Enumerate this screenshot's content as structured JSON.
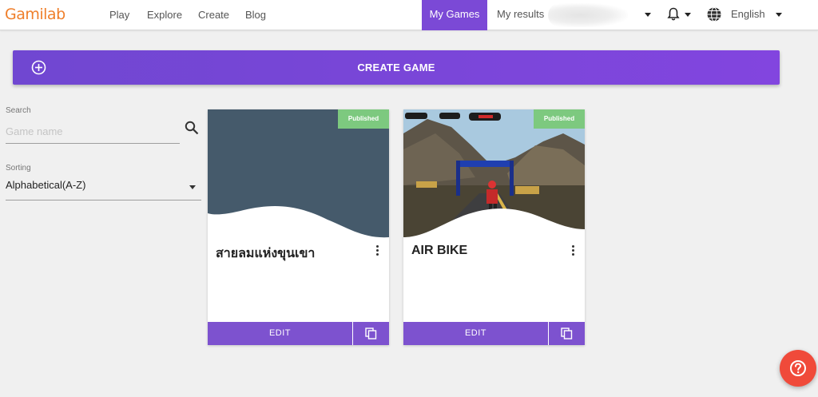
{
  "header": {
    "logo": "Gamilab",
    "nav": [
      "Play",
      "Explore",
      "Create",
      "Blog"
    ],
    "my_games": "My Games",
    "my_results": "My results",
    "language": "English"
  },
  "create": {
    "label": "CREATE GAME"
  },
  "filters": {
    "search_label": "Search",
    "search_placeholder": "Game name",
    "search_value": "",
    "sorting_label": "Sorting",
    "sorting_value": "Alphabetical(A-Z)"
  },
  "games": [
    {
      "title": "สายลมแห่งขุนเขา",
      "status": "Published",
      "edit": "EDIT",
      "image": "solid",
      "image_color": "#455a6b"
    },
    {
      "title": "AIR BIKE",
      "status": "Published",
      "edit": "EDIT",
      "image": "air-bike-scene"
    }
  ],
  "colors": {
    "accent": "#7b49d6",
    "published": "#7dc97f",
    "logo": "#ef7f2b",
    "help": "#f04a3a"
  },
  "icons": [
    "plus-circle-icon",
    "search-icon",
    "bell-icon",
    "globe-icon",
    "more-vert-icon",
    "copy-icon",
    "help-icon",
    "chevron-down-icon"
  ]
}
